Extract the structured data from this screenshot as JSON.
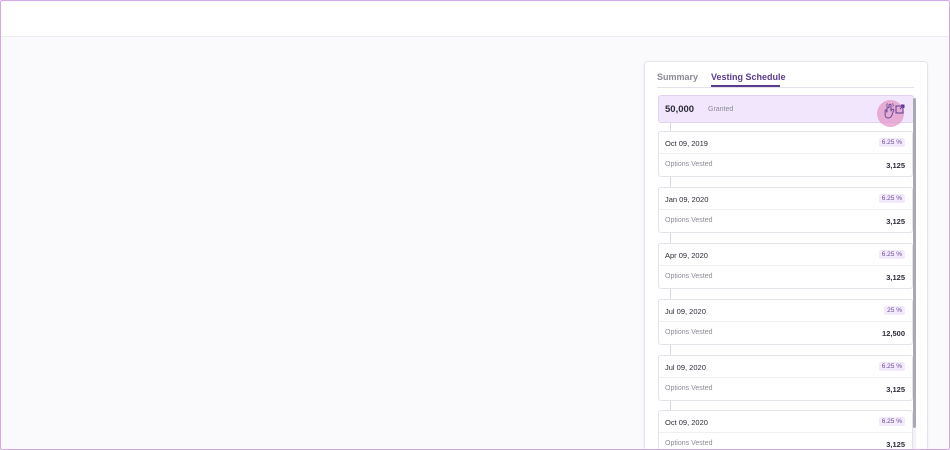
{
  "panel": {
    "tabs": [
      {
        "label": "Summary",
        "active": false
      },
      {
        "label": "Vesting Schedule",
        "active": true
      }
    ],
    "granted": {
      "value": "50,000",
      "label": "Granted"
    },
    "icons": {
      "touch": "hand-pointer-icon",
      "expand": "external-link-icon"
    },
    "schedule": [
      {
        "date": "Oct 09, 2019",
        "percent": "6.25 %",
        "label": "Options Vested",
        "value": "3,125"
      },
      {
        "date": "Jan 09, 2020",
        "percent": "6.25 %",
        "label": "Options Vested",
        "value": "3,125"
      },
      {
        "date": "Apr 09, 2020",
        "percent": "6.25 %",
        "label": "Options Vested",
        "value": "3,125"
      },
      {
        "date": "Jul 09, 2020",
        "percent": "25 %",
        "label": "Options Vested",
        "value": "12,500"
      },
      {
        "date": "Jul 09, 2020",
        "percent": "6.25 %",
        "label": "Options Vested",
        "value": "3,125"
      },
      {
        "date": "Oct 09, 2020",
        "percent": "6.25 %",
        "label": "Options Vested",
        "value": "3,125"
      }
    ]
  },
  "colors": {
    "accent": "#5b3b8c",
    "granted_bg": "#f1e6fb",
    "touch_halo": "#e296c8"
  }
}
